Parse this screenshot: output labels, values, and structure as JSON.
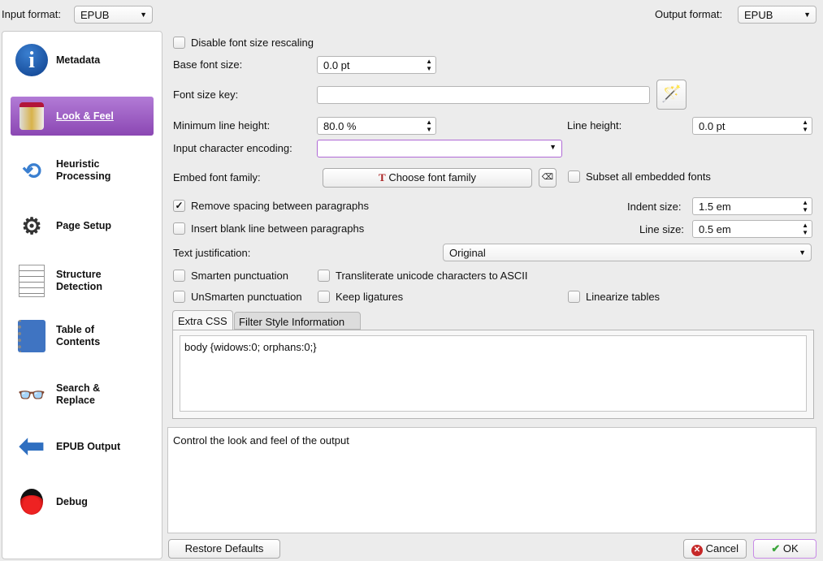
{
  "header": {
    "input_label": "Input format:",
    "input_value": "EPUB",
    "output_label": "Output format:",
    "output_value": "EPUB"
  },
  "sidebar": {
    "items": [
      {
        "label": "Metadata",
        "icon": "info-icon"
      },
      {
        "label": "Look & Feel",
        "icon": "paint-bucket-icon"
      },
      {
        "label": "Heuristic Processing",
        "icon": "heuristic-icon"
      },
      {
        "label": "Page Setup",
        "icon": "gears-icon"
      },
      {
        "label": "Structure Detection",
        "icon": "document-icon"
      },
      {
        "label": "Table of Contents",
        "icon": "notebook-icon"
      },
      {
        "label": "Search & Replace",
        "icon": "binoculars-icon"
      },
      {
        "label": "EPUB Output",
        "icon": "arrow-left-icon"
      },
      {
        "label": "Debug",
        "icon": "ladybug-icon"
      }
    ]
  },
  "form": {
    "disable_rescaling": "Disable font size rescaling",
    "base_font_label": "Base font size:",
    "base_font_value": "0.0 pt",
    "font_key_label": "Font size key:",
    "font_key_value": "",
    "min_line_label": "Minimum line height:",
    "min_line_value": "80.0 %",
    "line_height_label": "Line height:",
    "line_height_value": "0.0 pt",
    "encoding_label": "Input character encoding:",
    "encoding_value": "",
    "embed_label": "Embed font family:",
    "choose_font": "Choose font family",
    "subset": "Subset all embedded fonts",
    "remove_spacing": "Remove spacing between paragraphs",
    "indent_label": "Indent size:",
    "indent_value": "1.5 em",
    "insert_blank": "Insert blank line between paragraphs",
    "line_size_label": "Line size:",
    "line_size_value": "0.5 em",
    "justification_label": "Text justification:",
    "justification_value": "Original",
    "smarten": "Smarten punctuation",
    "transliterate": "Transliterate unicode characters to ASCII",
    "unsmarten": "UnSmarten punctuation",
    "ligatures": "Keep ligatures",
    "linearize": "Linearize tables",
    "tabs": [
      "Extra CSS",
      "Filter Style Information"
    ],
    "css": "body {widows:0; orphans:0;}"
  },
  "help": "Control the look and feel of the output",
  "footer": {
    "restore": "Restore Defaults",
    "cancel": "Cancel",
    "ok": "OK"
  }
}
